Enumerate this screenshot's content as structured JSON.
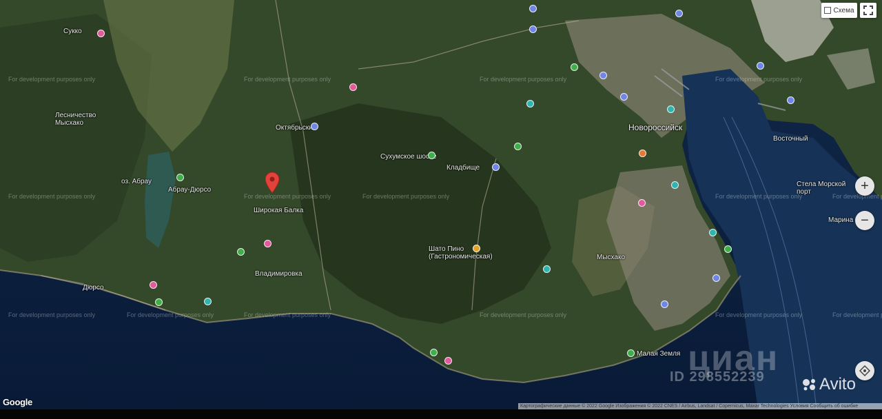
{
  "map": {
    "type": "satellite",
    "dev_watermark": "For development purposes only",
    "labels": {
      "novorossiysk": "Новороссийск",
      "vostochny": "Восточный",
      "lesnichestvo": "Лесничество Мысхако",
      "cemetery": "Кладбище",
      "sukko_road": "Сухумское шоссе",
      "shato_pino": "Шато Пино (Гастрономическая)",
      "myskhako": "Мысхако",
      "vladimirovka": "Владимировка",
      "abrau": "оз. Абрау",
      "abrau_durso": "Абрау-Дюрсо",
      "baleen": "Малая Земля",
      "marina": "Марина",
      "stella": "Стела Морской порт",
      "oktyabrsky": "Октябрьский",
      "shirokaya": "Широкая Балка",
      "sukko": "Сукко",
      "dyurso": "Дюрсо"
    }
  },
  "controls": {
    "scheme_label": "Схема",
    "zoom_in": "+",
    "zoom_out": "−"
  },
  "attribution": {
    "google": "Google",
    "copyright": "Картографические данные © 2022 Google  Изображения © 2022 CNES / Airbus, Landsat / Copernicus, Maxar Technologies  Условия  Сообщить об ошибке"
  },
  "watermarks": {
    "cian": "циан",
    "cian_id": "ID 298552239",
    "avito": "Avito"
  },
  "colors": {
    "land_dark": "#27361f",
    "land_mid": "#3c5230",
    "sea": "#0b1f3e",
    "urban": "#8a8474",
    "pin_red": "#e3423a"
  }
}
